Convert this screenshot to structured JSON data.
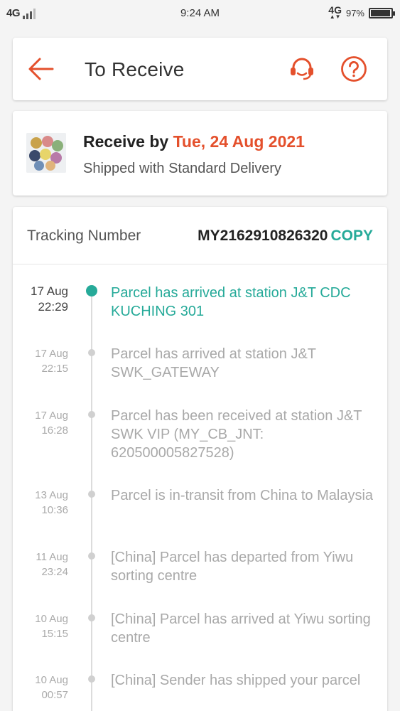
{
  "status_bar": {
    "network_left": "4G",
    "time": "9:24 AM",
    "network_right": "4G",
    "battery_percent": "97%",
    "battery_level": 0.97
  },
  "header": {
    "title": "To Receive",
    "back_icon": "arrow-left-icon",
    "support_icon": "headset-icon",
    "help_icon": "question-circle-icon",
    "accent_color": "#e4502c"
  },
  "delivery": {
    "receive_label": "Receive by ",
    "receive_date": "Tue, 24 Aug 2021",
    "shipping_method": "Shipped with Standard Delivery"
  },
  "tracking": {
    "label": "Tracking Number",
    "number": "MY2162910826320",
    "copy_label": "COPY",
    "copy_color": "#26aa99",
    "events": [
      {
        "date": "17 Aug",
        "time": "22:29",
        "text": "Parcel has arrived at station J&T CDC KUCHING 301",
        "active": true
      },
      {
        "date": "17 Aug",
        "time": "22:15",
        "text": "Parcel has arrived at station J&T SWK_GATEWAY",
        "active": false
      },
      {
        "date": "17 Aug",
        "time": "16:28",
        "text": "Parcel has been received at station J&T SWK VIP (MY_CB_JNT: 620500005827528)",
        "active": false
      },
      {
        "date": "13 Aug",
        "time": "10:36",
        "text": "Parcel is in-transit from China to Malaysia",
        "active": false
      },
      {
        "date": "11 Aug",
        "time": "23:24",
        "text": "[China] Parcel has departed from Yiwu sorting centre",
        "active": false
      },
      {
        "date": "10 Aug",
        "time": "15:15",
        "text": "[China] Parcel has arrived at Yiwu sorting centre",
        "active": false
      },
      {
        "date": "10 Aug",
        "time": "00:57",
        "text": "[China] Sender has shipped your parcel",
        "active": false
      }
    ]
  }
}
